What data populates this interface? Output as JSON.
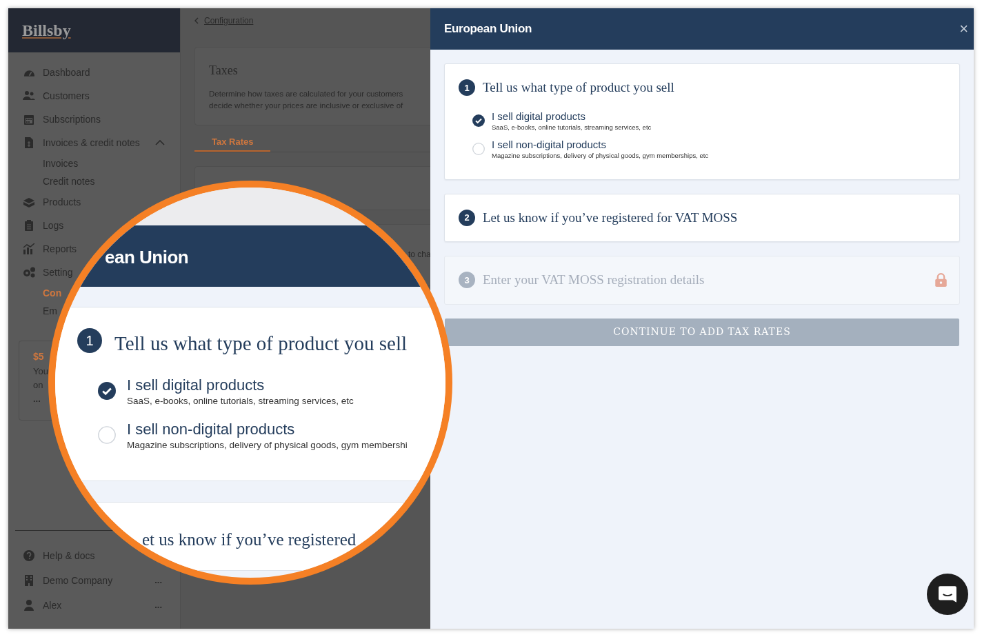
{
  "sidebar": {
    "logo": "Billsby",
    "items": [
      {
        "label": "Dashboard"
      },
      {
        "label": "Customers"
      },
      {
        "label": "Subscriptions"
      },
      {
        "label": "Invoices & credit notes",
        "expanded": true,
        "children": [
          {
            "label": "Invoices",
            "selected": false
          },
          {
            "label": "Credit notes",
            "selected": false
          }
        ]
      },
      {
        "label": "Products"
      },
      {
        "label": "Logs"
      },
      {
        "label": "Reports"
      },
      {
        "label": "Setting",
        "children": [
          {
            "label": "Con",
            "selected": true
          },
          {
            "label": "Em",
            "selected": false
          }
        ]
      }
    ],
    "promo": {
      "price": "$5",
      "lines": [
        "You",
        "on"
      ],
      "more": "..."
    },
    "footer": [
      {
        "label": "Help & docs"
      },
      {
        "label": "Demo Company",
        "more": "..."
      },
      {
        "label": "Alex",
        "more": "..."
      }
    ]
  },
  "main": {
    "breadcrumb": "Configuration",
    "taxes_card": {
      "title": "Taxes",
      "lines": [
        "Determine how taxes are calculated for your customers",
        "decide whether your prices are inclusive or exclusive of"
      ]
    },
    "tabs": [
      {
        "label": "Tax Rates",
        "selected": true
      }
    ],
    "partial_text": "to cha"
  },
  "panel": {
    "title": "European Union",
    "close": "×",
    "steps": [
      {
        "number": "1",
        "title": "Tell us what type of product you sell",
        "locked": false,
        "options": [
          {
            "label": "I sell digital products",
            "description": "SaaS, e-books, online tutorials, streaming services, etc",
            "selected": true
          },
          {
            "label": "I sell non-digital products",
            "description": "Magazine subscriptions, delivery of physical goods, gym memberships, etc",
            "selected": false
          }
        ]
      },
      {
        "number": "2",
        "title": "Let us know if you’ve registered for VAT MOSS",
        "locked": false
      },
      {
        "number": "3",
        "title": "Enter your VAT MOSS registration details",
        "locked": true
      }
    ],
    "button": {
      "label": "CONTINUE TO ADD TAX RATES",
      "disabled": true
    }
  },
  "magnifier": {
    "header": "ean Union",
    "step_number": "1",
    "step_title": "Tell us what type of product you sell",
    "options": [
      {
        "label": "I sell digital products",
        "description": "SaaS, e-books, online tutorials, streaming services, etc",
        "selected": true
      },
      {
        "label": "I sell non-digital products",
        "description": "Magazine subscriptions, delivery of physical goods, gym membershi",
        "selected": false
      }
    ],
    "next_step_title": "et us know if you’ve registered"
  }
}
